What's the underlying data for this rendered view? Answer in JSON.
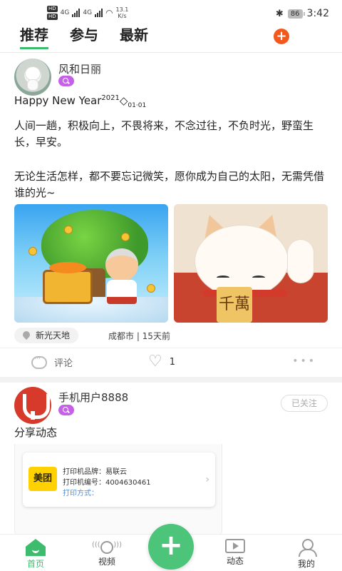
{
  "status_bar": {
    "hd1": "HD",
    "hd2": "HD",
    "net1": "4G",
    "net2": "4G",
    "speed_value": "13.1",
    "speed_unit": "K/s",
    "battery": "86",
    "time": "3:42"
  },
  "tabs": [
    {
      "label": "推荐",
      "active": true
    },
    {
      "label": "参与",
      "active": false
    },
    {
      "label": "最新",
      "active": false
    }
  ],
  "add_button": "+",
  "post1": {
    "username": "风和日丽",
    "title_main": "Happy New Year",
    "title_sup": "2021",
    "title_sym": "◇",
    "title_sub": "01·01",
    "paragraph1": "人间一趟，积极向上，不畏将来，不念过往，不负时光，野蛮生长，早安。",
    "paragraph2": "无论生活怎样，都不要忘记微笑，愿你成为自己的太阳，无需凭借谁的光~",
    "image2_text": "千萬",
    "location": "新光天地",
    "meta": "成都市 | 15天前",
    "comment_label": "评论",
    "like_count": "1",
    "more": "•••"
  },
  "post2": {
    "username": "手机用户8888",
    "follow_label": "已关注",
    "text": "分享动态",
    "card": {
      "logo": "美团",
      "line1": "打印机品牌：易联云",
      "line2": "打印机编号：4004630461",
      "line3": "打印方式：",
      "arrow": "›"
    }
  },
  "bottom_nav": {
    "home": "首页",
    "video": "视频",
    "fab": "+",
    "dynamic": "动态",
    "mine": "我的"
  },
  "colors": {
    "accent": "#3cbc6c",
    "orange": "#f25a1d",
    "badge": "#c660e8"
  }
}
